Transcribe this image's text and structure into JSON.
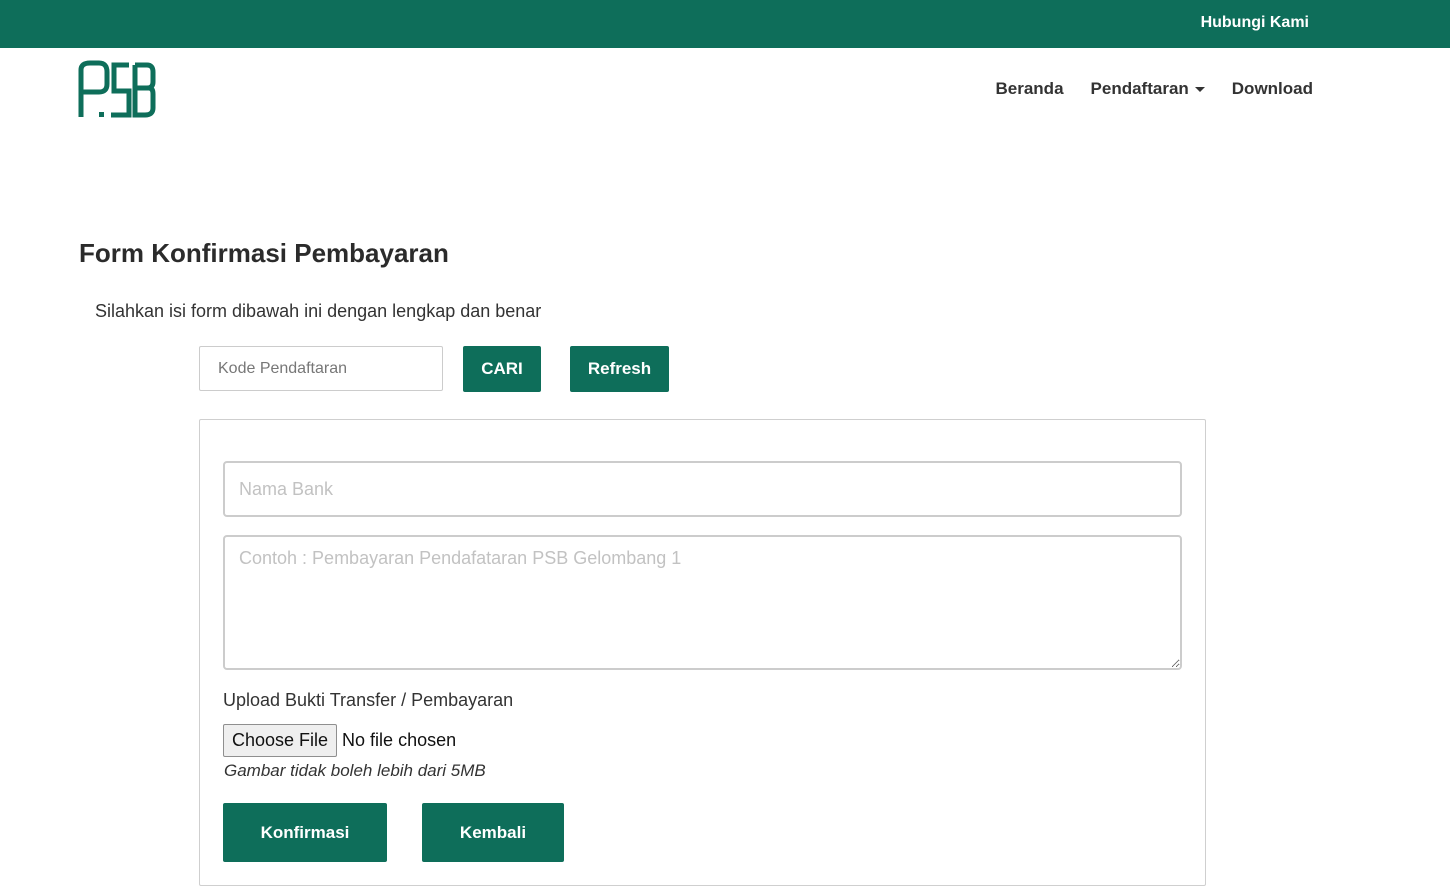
{
  "colors": {
    "brand": "#0e6e5a",
    "text": "#333333"
  },
  "topbar": {
    "contact_label": "Hubungi Kami"
  },
  "logo": {
    "text": "PSB",
    "icon": "psb-logo-icon"
  },
  "nav": {
    "beranda": "Beranda",
    "pendaftaran": "Pendaftaran",
    "download": "Download"
  },
  "page": {
    "title": "Form Konfirmasi Pembayaran",
    "intro": "Silahkan isi form dibawah ini dengan lengkap dan benar"
  },
  "search": {
    "placeholder": "Kode Pendaftaran",
    "cari_label": "CARI",
    "refresh_label": "Refresh"
  },
  "form": {
    "bank_placeholder": "Nama Bank",
    "desc_placeholder": "Contoh : Pembayaran Pendafataran PSB Gelombang 1",
    "upload_label": "Upload Bukti Transfer / Pembayaran",
    "choose_file_label": "Choose File",
    "file_status": "No file chosen",
    "file_note": "Gambar tidak boleh lebih dari 5MB",
    "confirm_label": "Konfirmasi",
    "back_label": "Kembali"
  }
}
